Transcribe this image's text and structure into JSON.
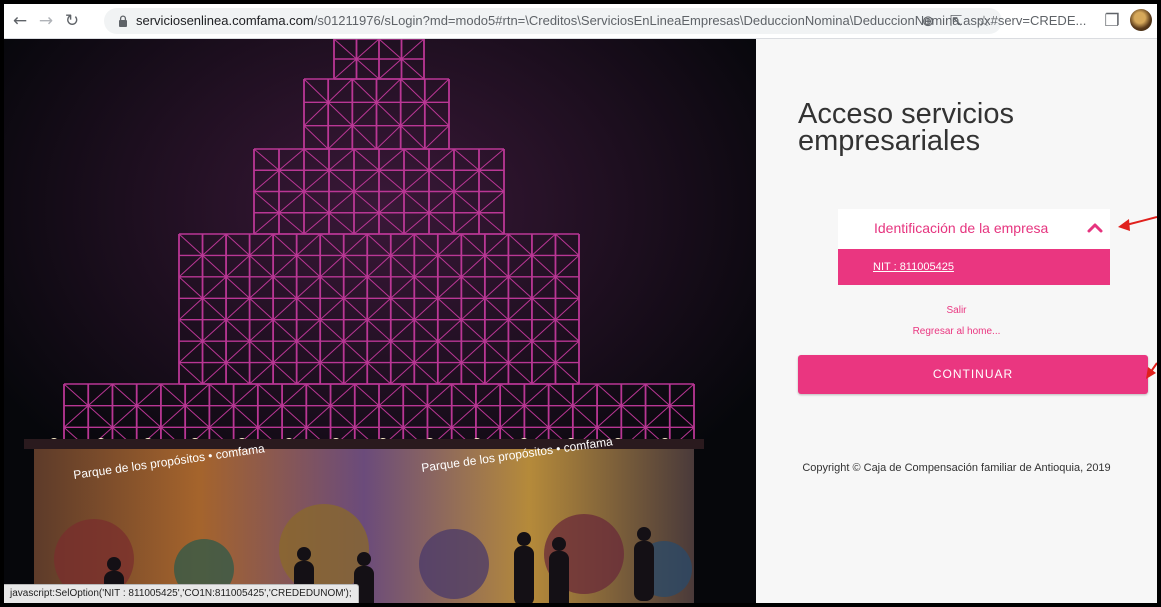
{
  "browser": {
    "url_host": "serviciosenlinea.comfama.com",
    "url_path": "/s01211976/sLogin?md=modo5#rtn=\\Creditos\\ServiciosEnLineaEmpresas\\DeduccionNomina\\DeduccionNomina.aspx#serv=CREDE...",
    "status_text": "javascript:SelOption('NIT : 811005425','CO1N:811005425','CREDEDUNOM');",
    "icons": [
      "back-icon",
      "forward-icon",
      "reload-icon",
      "lock-icon",
      "zoom-icon",
      "share-icon",
      "star-icon",
      "sidepanel-icon",
      "profile-avatar"
    ]
  },
  "hero": {
    "sign_text": "Parque de los propósitos • comfama",
    "accent_color": "#c2399b"
  },
  "login": {
    "title": "Acceso servicios empresariales",
    "accordion_header": "Identificación de la empresa",
    "nit_option": "NIT : 811005425",
    "salir": "Salir",
    "regresar": "Regresar al home...",
    "continue_button": "CONTINUAR",
    "copyright": "Copyright © Caja de Compensación familiar de Antioquia, 2019"
  },
  "colors": {
    "brand_pink": "#ea3680",
    "annotation_red": "#e0201c"
  }
}
